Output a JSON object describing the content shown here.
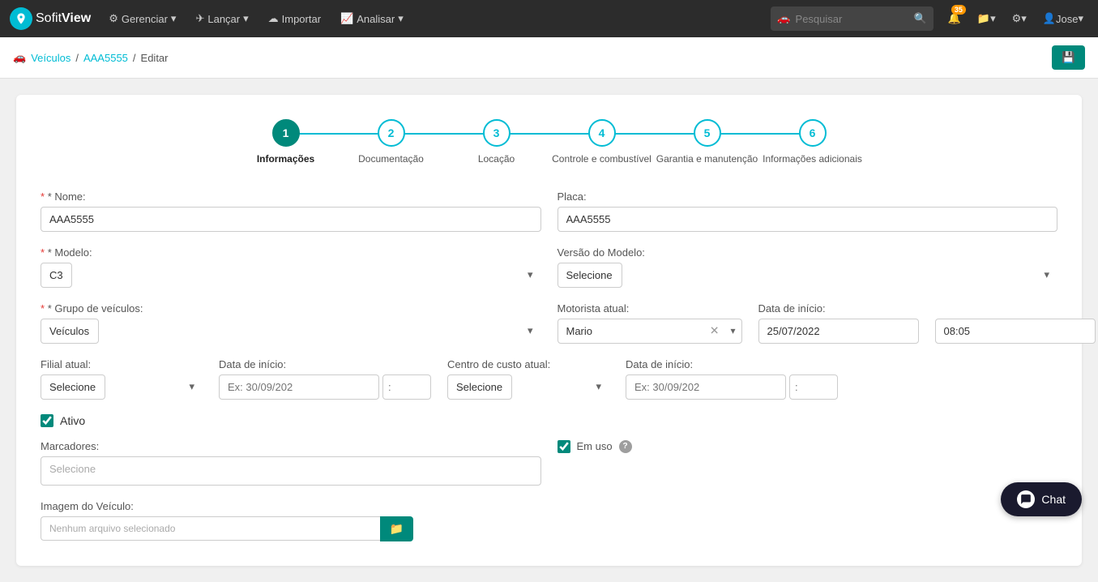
{
  "brand": {
    "icon": "S",
    "name_light": "Sofit",
    "name_bold": "View"
  },
  "navbar": {
    "items": [
      {
        "label": "Gerenciar",
        "icon": "⚙",
        "has_arrow": true
      },
      {
        "label": "Lançar",
        "icon": "✈",
        "has_arrow": true
      },
      {
        "label": "Importar",
        "icon": "☁",
        "has_arrow": false
      },
      {
        "label": "Analisar",
        "icon": "📈",
        "has_arrow": true
      }
    ],
    "search_placeholder": "Pesquisar",
    "notifications_count": "35",
    "user": "Jose"
  },
  "breadcrumb": {
    "links": [
      "Veículos",
      "AAA5555"
    ],
    "current": "Editar"
  },
  "stepper": {
    "steps": [
      {
        "number": "1",
        "label": "Informações",
        "active": true
      },
      {
        "number": "2",
        "label": "Documentação",
        "active": false
      },
      {
        "number": "3",
        "label": "Locação",
        "active": false
      },
      {
        "number": "4",
        "label": "Controle e combustível",
        "active": false
      },
      {
        "number": "5",
        "label": "Garantia e manutenção",
        "active": false
      },
      {
        "number": "6",
        "label": "Informações adicionais",
        "active": false
      }
    ]
  },
  "form": {
    "nome_label": "* Nome:",
    "nome_value": "AAA5555",
    "placa_label": "Placa:",
    "placa_value": "AAA5555",
    "modelo_label": "* Modelo:",
    "modelo_value": "C3",
    "modelo_placeholder": "C3",
    "versao_label": "Versão do Modelo:",
    "versao_placeholder": "Selecione",
    "grupo_label": "* Grupo de veículos:",
    "grupo_value": "Veículos",
    "motorista_label": "Motorista atual:",
    "motorista_value": "Mario",
    "data_inicio_label": "Data de início:",
    "data_inicio_value": "25/07/2022",
    "hora_value": "08:05",
    "filial_label": "Filial atual:",
    "filial_placeholder": "Selecione",
    "data_inicio2_label": "Data de início:",
    "data_inicio2_placeholder": "Ex: 30/09/202",
    "hora2_placeholder": ":",
    "centro_label": "Centro de custo atual:",
    "centro_placeholder": "Selecione",
    "data_inicio3_label": "Data de início:",
    "data_inicio3_placeholder": "Ex: 30/09/202",
    "hora3_placeholder": ":",
    "ativo_label": "Ativo",
    "marcadores_label": "Marcadores:",
    "marcadores_placeholder": "Selecione",
    "em_uso_label": "Em uso",
    "imagem_label": "Imagem do Veículo:",
    "imagem_placeholder": "Nenhum arquivo selecionado"
  },
  "chat": {
    "label": "Chat"
  }
}
